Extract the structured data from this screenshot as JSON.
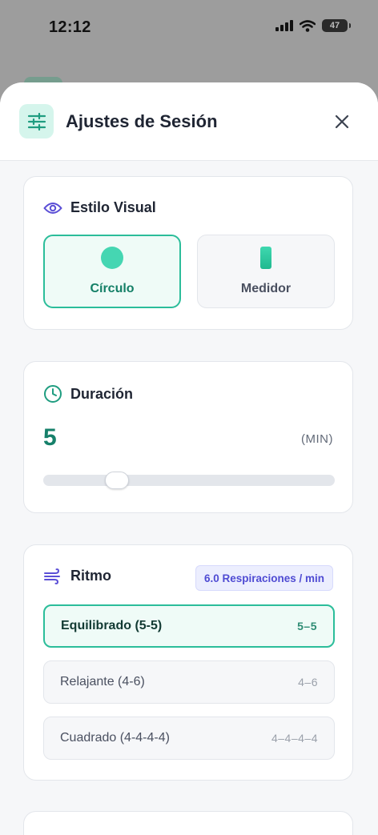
{
  "status_bar": {
    "time": "12:12",
    "battery": "47"
  },
  "header": {
    "title": "Ajustes de Sesión",
    "icon": "sliders-icon",
    "close_icon": "close-icon"
  },
  "visual_style": {
    "title": "Estilo Visual",
    "icon": "eye-icon",
    "options": [
      {
        "label": "Círculo",
        "icon": "circle-icon",
        "selected": true
      },
      {
        "label": "Medidor",
        "icon": "gauge-bar-icon",
        "selected": false
      }
    ]
  },
  "duration": {
    "title": "Duración",
    "icon": "clock-icon",
    "value": "5",
    "unit": "(MIN)",
    "slider_fraction": 0.23
  },
  "rhythm": {
    "title": "Ritmo",
    "icon": "wind-icon",
    "rate_badge": "6.0 Respiraciones / min",
    "options": [
      {
        "name": "Equilibrado (5-5)",
        "pattern": "5–5",
        "selected": true
      },
      {
        "name": "Relajante (4-6)",
        "pattern": "4–6",
        "selected": false
      },
      {
        "name": "Cuadrado (4-4-4-4)",
        "pattern": "4–4–4–4",
        "selected": false
      }
    ]
  },
  "colors": {
    "accent": "#2bbd9a",
    "accent_dark": "#16806a",
    "badge_text": "#4f4bd3",
    "icon_purple": "#5b4fd6"
  }
}
